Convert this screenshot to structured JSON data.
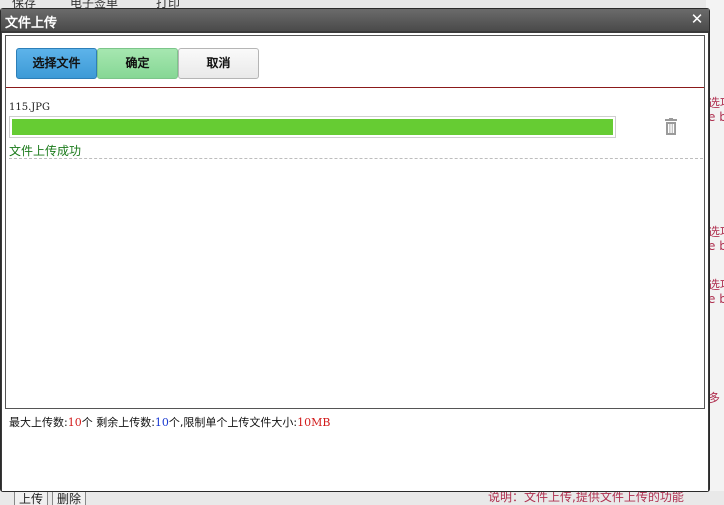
{
  "background": {
    "toolbar": [
      "保存",
      "电子签单",
      "打印"
    ],
    "right_fragments": [
      "选项",
      "e b",
      "选项",
      "e b",
      "选项",
      "e b",
      "多"
    ],
    "bottom_buttons": [
      "上传",
      "删除"
    ],
    "bottom_note": "说明：文件上传,提供文件上传的功能"
  },
  "dialog": {
    "title": "文件上传",
    "close_glyph": "✕",
    "buttons": {
      "select_label": "选择文件",
      "ok_label": "确定",
      "cancel_label": "取消"
    },
    "file": {
      "name": "115.JPG",
      "progress": 1.0,
      "status": "文件上传成功",
      "delete_icon": "trash-icon"
    },
    "limits": {
      "max_label": "最大上传数:",
      "max_value": "10",
      "max_unit": "个",
      "remain_label": " 剩余上传数:",
      "remain_value": "10",
      "remain_unit": "个",
      "size_label": ",限制单个上传文件大小:",
      "size_value": "10MB"
    }
  },
  "colors": {
    "select_button": "#3d9ad6",
    "ok_button": "#86d795",
    "progress": "#66cc33",
    "status_text": "#1a7a1a",
    "limit_red": "#d21c1c",
    "limit_blue": "#1a3ad2",
    "divider": "#8b1a1a"
  }
}
